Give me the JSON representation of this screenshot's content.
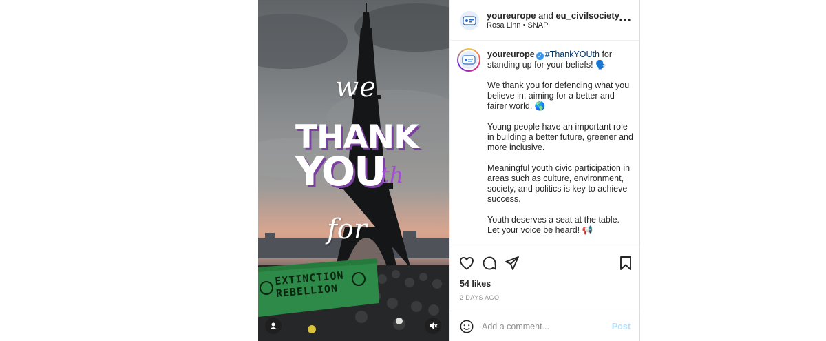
{
  "media": {
    "overlay_we": "we",
    "overlay_thank": "THANK",
    "overlay_you": "YOU",
    "overlay_th": "th",
    "overlay_for": "for",
    "banner_text": "EXTINCTION REBELLION",
    "user_icon": "user-icon",
    "mute_icon": "speaker-muted-icon"
  },
  "header": {
    "account": "youreurope",
    "connector": " and ",
    "collaborator": "eu_civilsociety",
    "music_artist": "Rosa Linn",
    "separator": " • ",
    "music_title": "SNAP",
    "more_icon": "more-horizontal-icon"
  },
  "caption": {
    "username": "youreurope",
    "hashtag": "#ThankYOUth",
    "line1_rest": " for standing up for your beliefs! 🗣️",
    "para2": "We thank you for defending what you believe in, aiming for a better and fairer world. 🌎",
    "para3": "Young people have an important role in building a better future, greener and more inclusive.",
    "para4": "Meaningful youth civic participation in areas such as culture, environment, society, and politics is key to achieve success.",
    "para5": "Youth deserves a seat at the table. Let your voice be heard! 📢"
  },
  "actions": {
    "like_icon": "heart-icon",
    "comment_icon": "comment-icon",
    "share_icon": "share-icon",
    "save_icon": "bookmark-icon"
  },
  "stats": {
    "likes": "54 likes",
    "date": "2 DAYS AGO"
  },
  "comment": {
    "placeholder": "Add a comment...",
    "post_label": "Post",
    "emoji_icon": "emoji-icon"
  },
  "colors": {
    "accent": "#3897f0",
    "post_disabled": "#b2dffc",
    "overlay_purple": "#7b3fa0"
  }
}
